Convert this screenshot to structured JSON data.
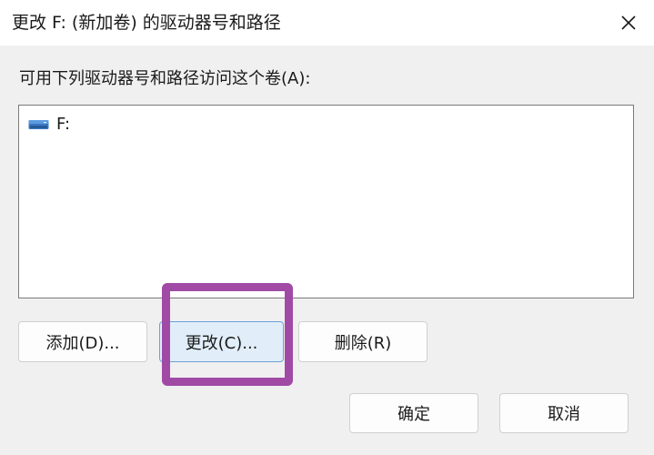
{
  "window": {
    "title": "更改 F: (新加卷) 的驱动器号和路径",
    "close_icon": "close-icon"
  },
  "prompt": "可用下列驱动器号和路径访问这个卷(A):",
  "list": {
    "items": [
      {
        "label": "F:",
        "icon": "drive-icon"
      }
    ]
  },
  "buttons": {
    "add": "添加(D)...",
    "change": "更改(C)...",
    "remove": "删除(R)",
    "ok": "确定",
    "cancel": "取消"
  },
  "colors": {
    "highlight": "#a04aa6",
    "focused_button_bg": "#e1eefa",
    "focused_button_border": "#6aa0d8"
  }
}
